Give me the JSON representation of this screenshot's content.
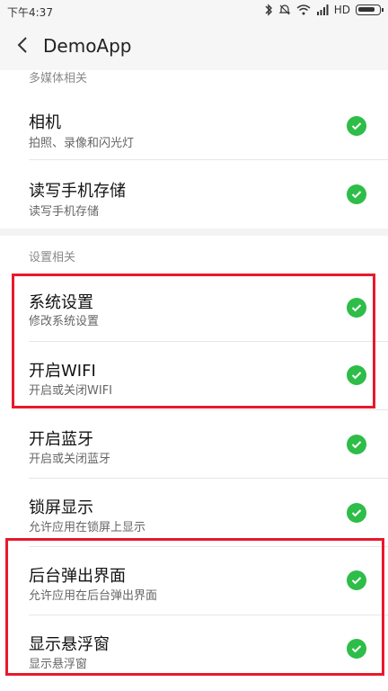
{
  "status_bar": {
    "time": "下午4:37",
    "icons": [
      "bluetooth-icon",
      "mute-icon",
      "wifi-icon",
      "signal-icon"
    ],
    "network": "HD",
    "battery_icon": "battery-icon"
  },
  "app_bar": {
    "back_icon": "back-arrow-icon",
    "title": "DemoApp"
  },
  "sections": [
    {
      "header": "多媒体相关",
      "items": [
        {
          "title": "相机",
          "subtitle": "拍照、录像和闪光灯",
          "checked": true
        },
        {
          "title": "读写手机存储",
          "subtitle": "读写手机存储",
          "checked": true
        }
      ]
    },
    {
      "header": "设置相关",
      "items": [
        {
          "title": "系统设置",
          "subtitle": "修改系统设置",
          "checked": true
        },
        {
          "title": "开启WIFI",
          "subtitle": "开启或关闭WIFI",
          "checked": true
        },
        {
          "title": "开启蓝牙",
          "subtitle": "开启或关闭蓝牙",
          "checked": true
        },
        {
          "title": "锁屏显示",
          "subtitle": "允许应用在锁屏上显示",
          "checked": true
        },
        {
          "title": "后台弹出界面",
          "subtitle": "允许应用在后台弹出界面",
          "checked": true
        },
        {
          "title": "显示悬浮窗",
          "subtitle": "显示悬浮窗",
          "checked": true
        }
      ]
    }
  ],
  "colors": {
    "check_green": "#2ebd48",
    "highlight_red": "#e8192c"
  }
}
